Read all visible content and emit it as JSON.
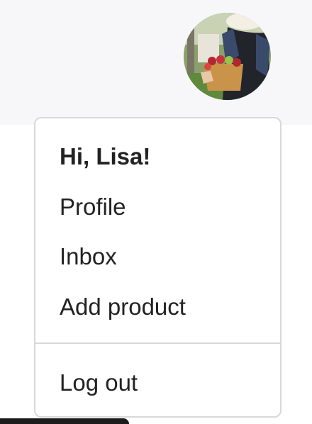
{
  "user": {
    "avatar_icon": "user-avatar"
  },
  "menu": {
    "greeting": "Hi, Lisa!",
    "items": [
      {
        "label": "Profile"
      },
      {
        "label": "Inbox"
      },
      {
        "label": "Add product"
      }
    ],
    "logout_label": "Log out"
  },
  "colors": {
    "text": "#222222",
    "border": "#d8d8d8",
    "header_background": "#f7f7fa"
  }
}
